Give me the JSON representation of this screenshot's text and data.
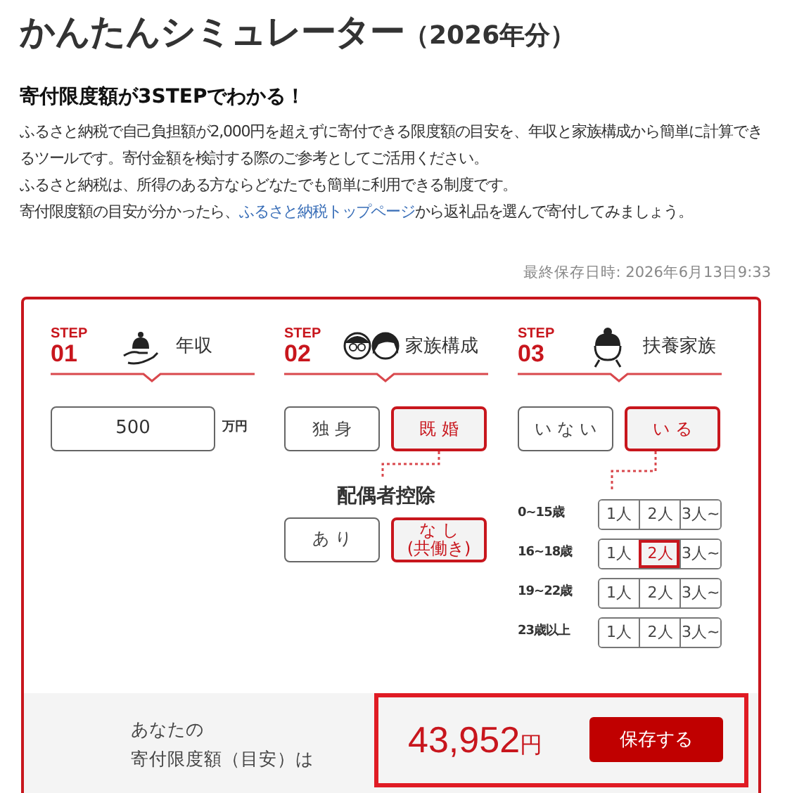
{
  "title": "かんたんシミュレーター",
  "title_suffix": "（2026年分）",
  "lead": {
    "heading": "寄付限度額が3STEPでわかる！",
    "paragraphs": [
      {
        "text": "ふるさと納税で自己負担額が2,000円を超えずに寄付できる限度額の目安を、年収と家族構成から簡単に計算できるツールです。寄付金額を検討する際のご参考としてご活用ください。"
      },
      {
        "text": "ふるさと納税は、所得のある方ならどなたでも簡単に利用できる制度です。"
      },
      {
        "text": "寄付限度額の目安が分かったら、",
        "link": "ふるさと納税トップページ",
        "after": "から返礼品を選んで寄付してみましょう。"
      }
    ]
  },
  "last_saved": "最終保存日時: 2026年6月13日9:33",
  "steps": [
    {
      "label": "STEP",
      "number": "01",
      "title": "年収"
    },
    {
      "label": "STEP",
      "number": "02",
      "title": "家族構成"
    },
    {
      "label": "STEP",
      "number": "03",
      "title": "扶養家族"
    }
  ],
  "income": {
    "value": "500",
    "unit": "万円"
  },
  "family": [
    {
      "label": "独 身",
      "selected": false
    },
    {
      "label": "既 婚",
      "selected": true
    }
  ],
  "spouse_deduction": {
    "title": "配偶者控除",
    "options": [
      {
        "label": "あ り",
        "selected": false
      },
      {
        "label": "な し",
        "note": "(共働き)",
        "selected": true
      }
    ]
  },
  "dependents": [
    {
      "label": "い な い",
      "selected": false
    },
    {
      "label": "い る",
      "selected": true
    }
  ],
  "age_groups": [
    {
      "label": "0~15歳",
      "options": [
        {
          "label": "1人",
          "selected": false
        },
        {
          "label": "2人",
          "selected": false
        },
        {
          "label": "3人~",
          "selected": false
        }
      ]
    },
    {
      "label": "16~18歳",
      "options": [
        {
          "label": "1人",
          "selected": false
        },
        {
          "label": "2人",
          "selected": true
        },
        {
          "label": "3人~",
          "selected": false
        }
      ]
    },
    {
      "label": "19~22歳",
      "options": [
        {
          "label": "1人",
          "selected": false
        },
        {
          "label": "2人",
          "selected": false
        },
        {
          "label": "3人~",
          "selected": false
        }
      ]
    },
    {
      "label": "23歳以上",
      "options": [
        {
          "label": "1人",
          "selected": false
        },
        {
          "label": "2人",
          "selected": false
        },
        {
          "label": "3人~",
          "selected": false
        }
      ]
    }
  ],
  "result": {
    "label_lines": [
      "あなたの",
      "寄付限度額（目安）は"
    ],
    "amount": "43,952",
    "unit": "円",
    "button": "保存する"
  }
}
